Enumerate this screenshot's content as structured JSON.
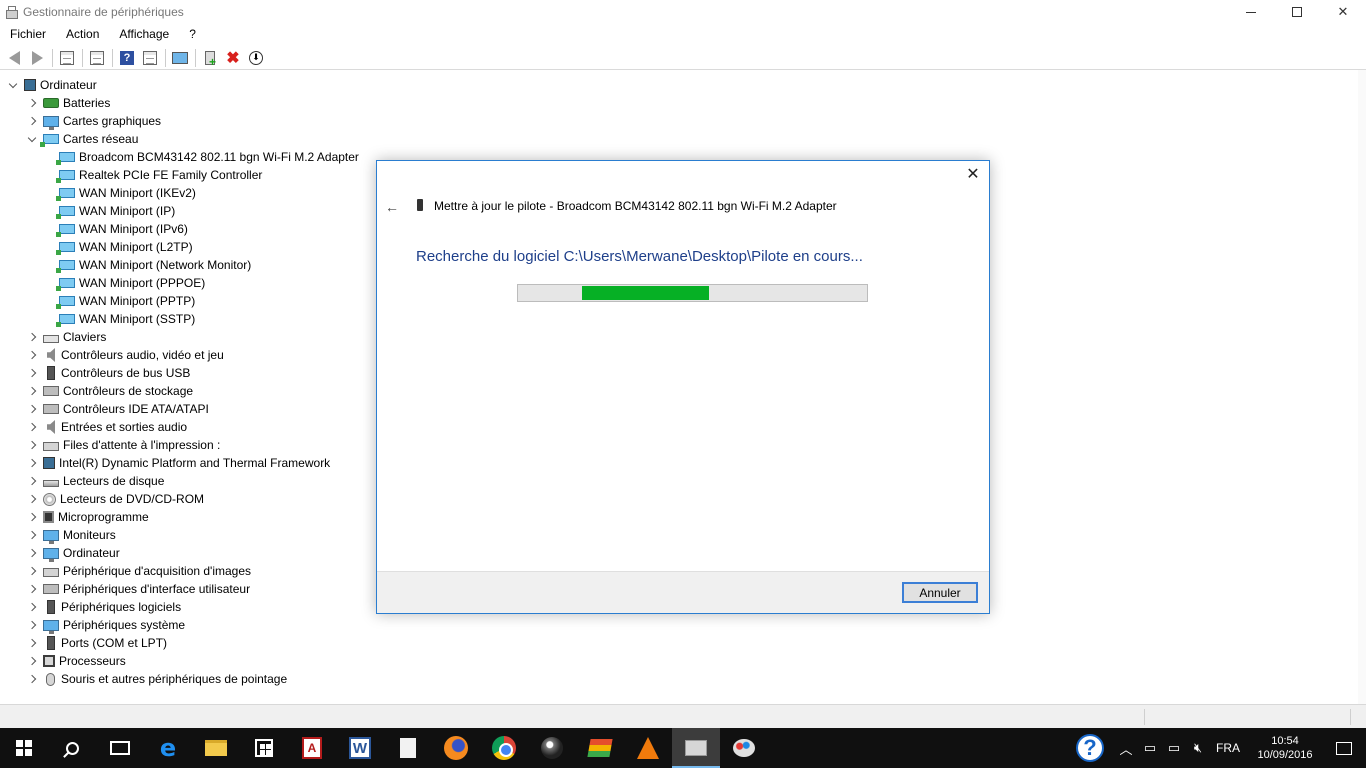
{
  "window": {
    "title": "Gestionnaire de périphériques"
  },
  "menu": [
    "Fichier",
    "Action",
    "Affichage",
    "?"
  ],
  "toolbar": {
    "icons": [
      "back-arrow-icon",
      "forward-arrow-icon",
      "properties-icon",
      "list-icon",
      "help-icon",
      "console-icon",
      "monitor-icon",
      "add-driver-icon",
      "uninstall-icon",
      "download-icon"
    ]
  },
  "tree": {
    "root": "Ordinateur",
    "categories": [
      {
        "label": "Batteries",
        "icon": "battery-icon",
        "expanded": false
      },
      {
        "label": "Cartes graphiques",
        "icon": "monitor-icon",
        "expanded": false
      },
      {
        "label": "Cartes réseau",
        "icon": "network-icon",
        "expanded": true,
        "children": [
          "Broadcom BCM43142 802.11 bgn Wi-Fi M.2 Adapter",
          "Realtek PCIe FE Family Controller",
          "WAN Miniport (IKEv2)",
          "WAN Miniport (IP)",
          "WAN Miniport (IPv6)",
          "WAN Miniport (L2TP)",
          "WAN Miniport (Network Monitor)",
          "WAN Miniport (PPPOE)",
          "WAN Miniport (PPTP)",
          "WAN Miniport (SSTP)"
        ]
      },
      {
        "label": "Claviers",
        "icon": "keyboard-icon",
        "expanded": false
      },
      {
        "label": "Contrôleurs audio, vidéo et jeu",
        "icon": "speaker-icon",
        "expanded": false
      },
      {
        "label": "Contrôleurs de bus USB",
        "icon": "usb-icon",
        "expanded": false
      },
      {
        "label": "Contrôleurs de stockage",
        "icon": "storage-icon",
        "expanded": false
      },
      {
        "label": "Contrôleurs IDE ATA/ATAPI",
        "icon": "ide-icon",
        "expanded": false
      },
      {
        "label": "Entrées et sorties audio",
        "icon": "speaker-icon",
        "expanded": false
      },
      {
        "label": "Files d'attente à l'impression :",
        "icon": "printer-icon",
        "expanded": false
      },
      {
        "label": "Intel(R) Dynamic Platform and Thermal Framework",
        "icon": "computer-icon",
        "expanded": false
      },
      {
        "label": "Lecteurs de disque",
        "icon": "disk-icon",
        "expanded": false
      },
      {
        "label": "Lecteurs de DVD/CD-ROM",
        "icon": "cd-icon",
        "expanded": false
      },
      {
        "label": "Microprogramme",
        "icon": "chip-icon",
        "expanded": false
      },
      {
        "label": "Moniteurs",
        "icon": "monitor-icon",
        "expanded": false
      },
      {
        "label": "Ordinateur",
        "icon": "monitor-icon",
        "expanded": false
      },
      {
        "label": "Périphérique d'acquisition d'images",
        "icon": "camera-icon",
        "expanded": false
      },
      {
        "label": "Périphériques d'interface utilisateur",
        "icon": "hid-icon",
        "expanded": false
      },
      {
        "label": "Périphériques logiciels",
        "icon": "software-device-icon",
        "expanded": false
      },
      {
        "label": "Périphériques système",
        "icon": "system-device-icon",
        "expanded": false
      },
      {
        "label": "Ports (COM et LPT)",
        "icon": "port-icon",
        "expanded": false
      },
      {
        "label": "Processeurs",
        "icon": "cpu-icon",
        "expanded": false
      },
      {
        "label": "Souris et autres périphériques de pointage",
        "icon": "mouse-icon",
        "expanded": false
      }
    ]
  },
  "dialog": {
    "header_title": "Mettre à jour le pilote - Broadcom BCM43142 802.11 bgn Wi-Fi M.2 Adapter",
    "status": "Recherche du logiciel C:\\Users\\Merwane\\Desktop\\Pilote en cours...",
    "progress": "indeterminate",
    "cancel_label": "Annuler",
    "close_glyph": "✕",
    "back_glyph": "←"
  },
  "taskbar": {
    "apps": [
      "start-icon",
      "search-icon",
      "task-view-icon",
      "edge-icon",
      "file-explorer-icon",
      "store-icon",
      "acrobat-icon",
      "word-icon",
      "document-icon",
      "firefox-icon",
      "chrome-icon",
      "globe-app-icon",
      "stack-app-icon",
      "vlc-icon",
      "device-manager-icon",
      "paint-icon"
    ],
    "active_app": "device-manager-icon",
    "language": "FRA",
    "time": "10:54",
    "date": "10/09/2016"
  },
  "colors": {
    "progress_fill": "#06b025",
    "dialog_border": "#2a7dd0",
    "status_text": "#1e3f8a",
    "taskbar_bg": "#101010"
  }
}
